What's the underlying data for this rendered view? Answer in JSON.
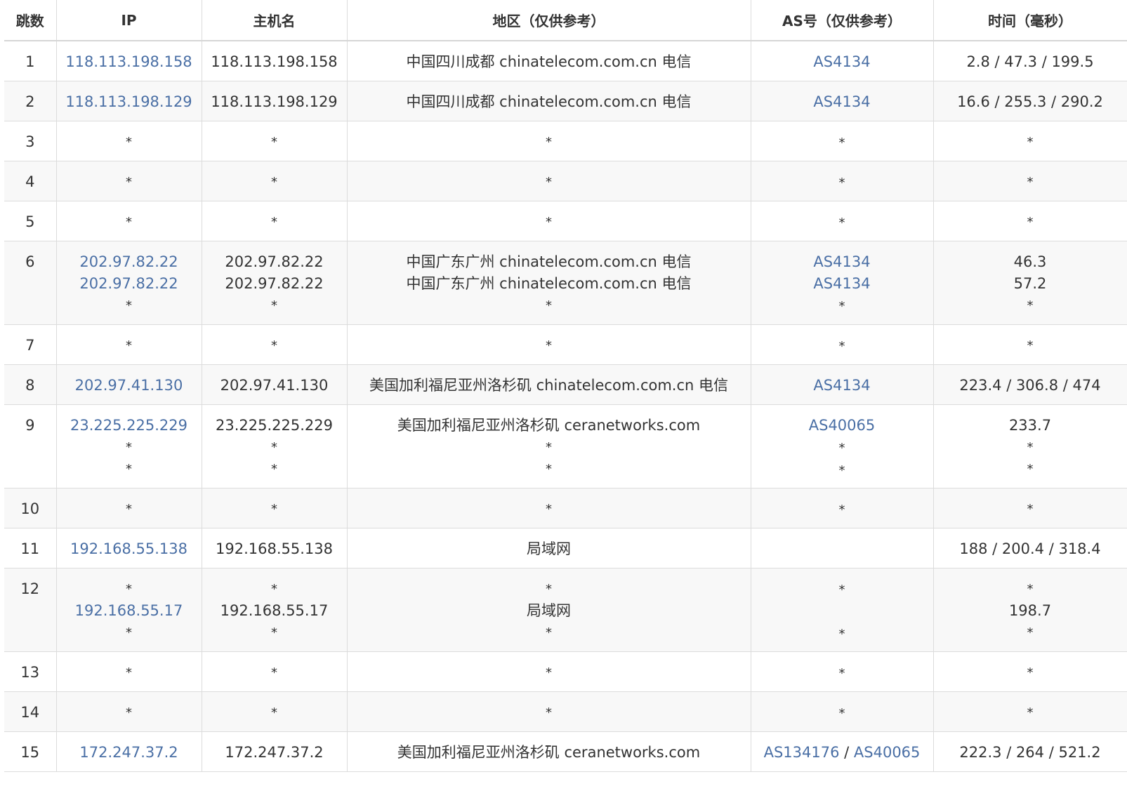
{
  "headers": {
    "hop": "跳数",
    "ip": "IP",
    "hostname": "主机名",
    "region": "地区（仅供参考）",
    "asn": "AS号（仅供参考）",
    "time": "时间（毫秒）"
  },
  "rows": [
    {
      "hop": "1",
      "ip": [
        "118.113.198.158"
      ],
      "hostname": [
        "118.113.198.158"
      ],
      "region": [
        "中国四川成都 chinatelecom.com.cn 电信"
      ],
      "asn": [
        [
          "AS4134"
        ]
      ],
      "time": [
        "2.8 / 47.3 / 199.5"
      ]
    },
    {
      "hop": "2",
      "ip": [
        "118.113.198.129"
      ],
      "hostname": [
        "118.113.198.129"
      ],
      "region": [
        "中国四川成都 chinatelecom.com.cn 电信"
      ],
      "asn": [
        [
          "AS4134"
        ]
      ],
      "time": [
        "16.6 / 255.3 / 290.2"
      ]
    },
    {
      "hop": "3",
      "ip": [
        "*"
      ],
      "hostname": [
        "*"
      ],
      "region": [
        "*"
      ],
      "asn": [
        [
          "*"
        ]
      ],
      "time": [
        "*"
      ]
    },
    {
      "hop": "4",
      "ip": [
        "*"
      ],
      "hostname": [
        "*"
      ],
      "region": [
        "*"
      ],
      "asn": [
        [
          "*"
        ]
      ],
      "time": [
        "*"
      ]
    },
    {
      "hop": "5",
      "ip": [
        "*"
      ],
      "hostname": [
        "*"
      ],
      "region": [
        "*"
      ],
      "asn": [
        [
          "*"
        ]
      ],
      "time": [
        "*"
      ]
    },
    {
      "hop": "6",
      "ip": [
        "202.97.82.22",
        "202.97.82.22",
        "*"
      ],
      "hostname": [
        "202.97.82.22",
        "202.97.82.22",
        "*"
      ],
      "region": [
        "中国广东广州 chinatelecom.com.cn 电信",
        "中国广东广州 chinatelecom.com.cn 电信",
        "*"
      ],
      "asn": [
        [
          "AS4134"
        ],
        [
          "AS4134"
        ],
        [
          "*"
        ]
      ],
      "time": [
        "46.3",
        "57.2",
        "*"
      ]
    },
    {
      "hop": "7",
      "ip": [
        "*"
      ],
      "hostname": [
        "*"
      ],
      "region": [
        "*"
      ],
      "asn": [
        [
          "*"
        ]
      ],
      "time": [
        "*"
      ]
    },
    {
      "hop": "8",
      "ip": [
        "202.97.41.130"
      ],
      "hostname": [
        "202.97.41.130"
      ],
      "region": [
        "美国加利福尼亚州洛杉矶 chinatelecom.com.cn 电信"
      ],
      "asn": [
        [
          "AS4134"
        ]
      ],
      "time": [
        "223.4 / 306.8 / 474"
      ]
    },
    {
      "hop": "9",
      "ip": [
        "23.225.225.229",
        "*",
        "*"
      ],
      "hostname": [
        "23.225.225.229",
        "*",
        "*"
      ],
      "region": [
        "美国加利福尼亚州洛杉矶 ceranetworks.com",
        "*",
        "*"
      ],
      "asn": [
        [
          "AS40065"
        ],
        [
          "*"
        ],
        [
          "*"
        ]
      ],
      "time": [
        "233.7",
        "*",
        "*"
      ]
    },
    {
      "hop": "10",
      "ip": [
        "*"
      ],
      "hostname": [
        "*"
      ],
      "region": [
        "*"
      ],
      "asn": [
        [
          "*"
        ]
      ],
      "time": [
        "*"
      ]
    },
    {
      "hop": "11",
      "ip": [
        "192.168.55.138"
      ],
      "hostname": [
        "192.168.55.138"
      ],
      "region": [
        "局域网"
      ],
      "asn": [
        [
          ""
        ]
      ],
      "time": [
        "188 / 200.4 / 318.4"
      ]
    },
    {
      "hop": "12",
      "ip": [
        "*",
        "192.168.55.17",
        "*"
      ],
      "hostname": [
        "*",
        "192.168.55.17",
        "*"
      ],
      "region": [
        "*",
        "局域网",
        "*"
      ],
      "asn": [
        [
          "*"
        ],
        [
          ""
        ],
        [
          "*"
        ]
      ],
      "time": [
        "*",
        "198.7",
        "*"
      ]
    },
    {
      "hop": "13",
      "ip": [
        "*"
      ],
      "hostname": [
        "*"
      ],
      "region": [
        "*"
      ],
      "asn": [
        [
          "*"
        ]
      ],
      "time": [
        "*"
      ]
    },
    {
      "hop": "14",
      "ip": [
        "*"
      ],
      "hostname": [
        "*"
      ],
      "region": [
        "*"
      ],
      "asn": [
        [
          "*"
        ]
      ],
      "time": [
        "*"
      ]
    },
    {
      "hop": "15",
      "ip": [
        "172.247.37.2"
      ],
      "hostname": [
        "172.247.37.2"
      ],
      "region": [
        "美国加利福尼亚州洛杉矶 ceranetworks.com"
      ],
      "asn": [
        [
          "AS134176",
          "AS40065"
        ]
      ],
      "time": [
        "222.3 / 264 / 521.2"
      ]
    }
  ],
  "colors": {
    "link": "#4a6fa5",
    "stripe": "#f8f8f8",
    "border": "#dcdcdc"
  }
}
